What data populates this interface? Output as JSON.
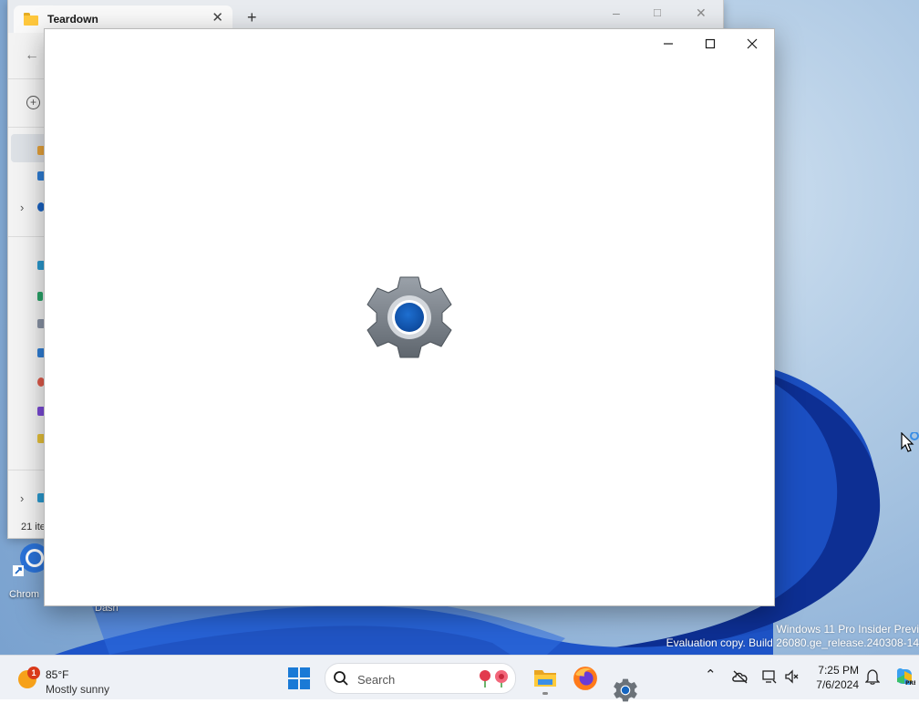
{
  "explorer": {
    "tab_title": "Teardown",
    "new_tab": "+",
    "tab_close": "✕",
    "status": "21 ite"
  },
  "desktop": {
    "icons": [
      {
        "label": "Chrom",
        "icon": "chrome-shortcut-icon"
      },
      {
        "label": "Dash",
        "icon": "dash-shortcut-icon"
      }
    ],
    "watermark": {
      "line1": "Windows 11 Pro Insider Previ",
      "line2": "Evaluation copy. Build 26080.ge_release.240308-14"
    }
  },
  "settings_window": {
    "icon": "gear-icon",
    "accent": "#1565c0"
  },
  "taskbar": {
    "weather": {
      "temp": "85°F",
      "condition": "Mostly sunny",
      "alert_count": "1"
    },
    "search": {
      "placeholder": "Search"
    },
    "apps": [
      {
        "name": "file-explorer",
        "icon": "folder-icon"
      },
      {
        "name": "firefox",
        "icon": "firefox-icon"
      },
      {
        "name": "settings",
        "icon": "gear-icon"
      }
    ],
    "clock": {
      "time": "7:25 PM",
      "date": "7/6/2024"
    }
  },
  "colors": {
    "taskbar_bg": "#eef1f6",
    "windows_blue": "#1a7ad6"
  }
}
